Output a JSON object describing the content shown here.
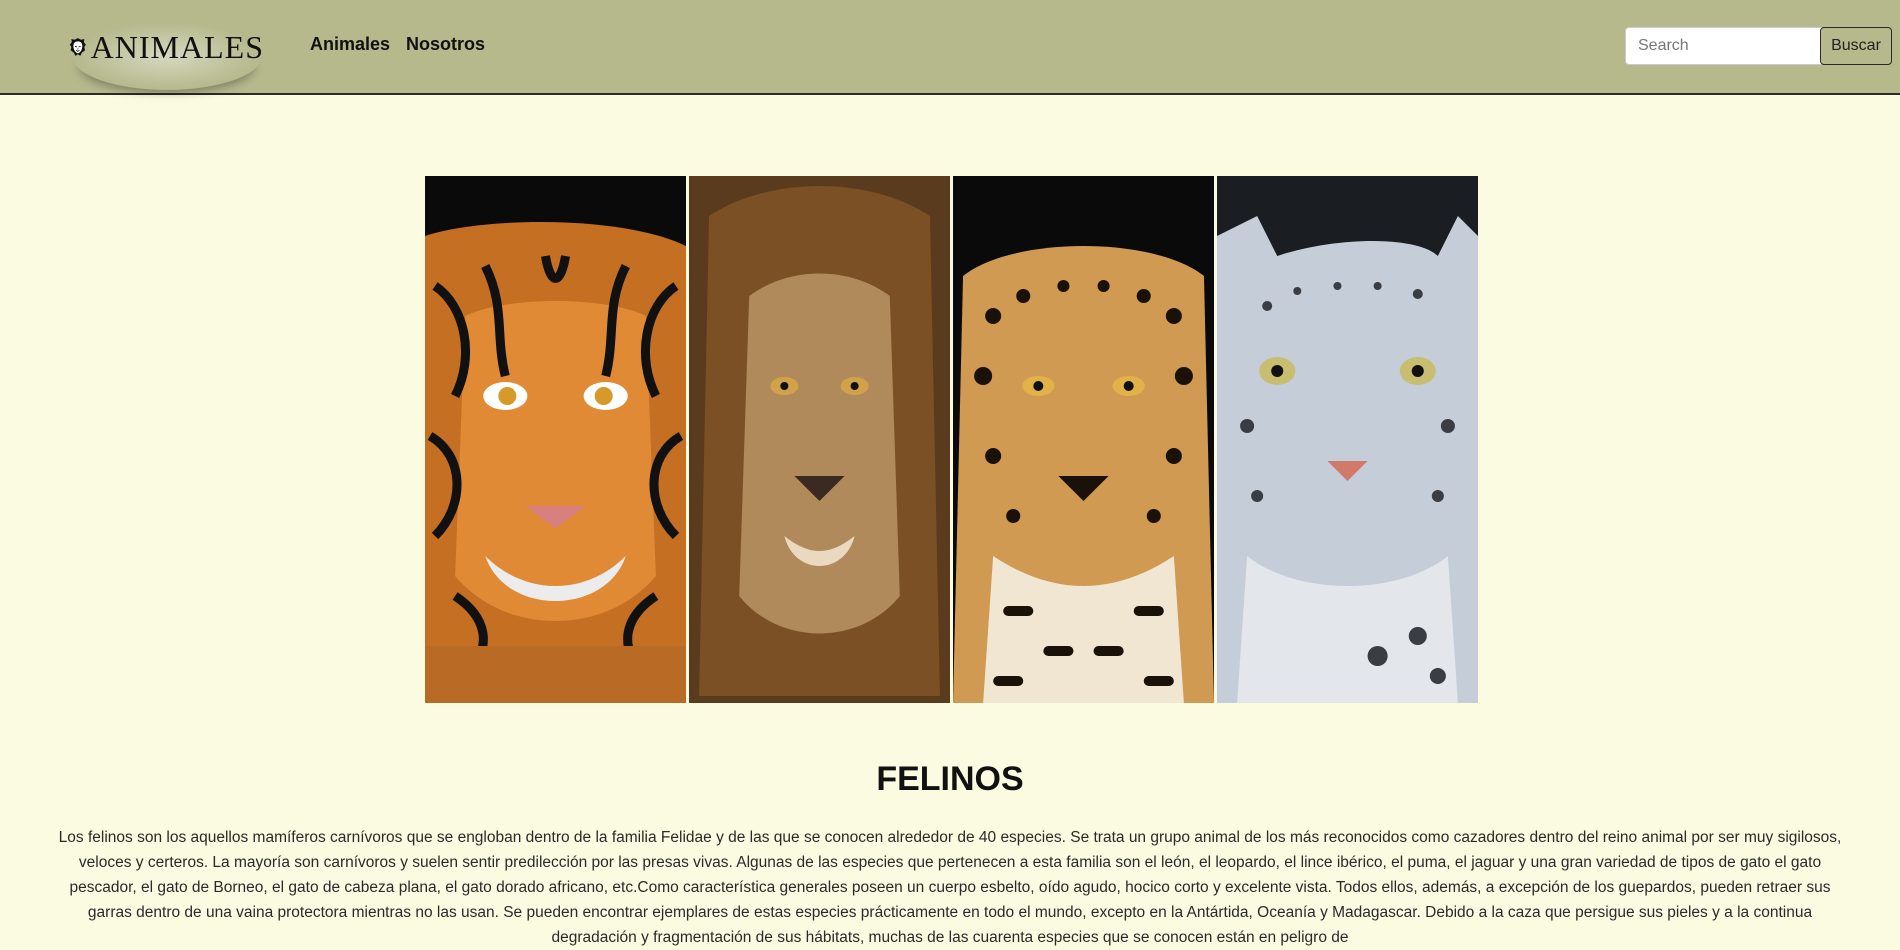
{
  "navbar": {
    "brand": "ANIMALES",
    "links": [
      "Animales",
      "Nosotros"
    ],
    "search": {
      "placeholder": "Search",
      "button_label": "Buscar"
    }
  },
  "hero": {
    "panels": [
      "tiger-image",
      "lion-image",
      "jaguar-image",
      "snow-leopard-image"
    ]
  },
  "section": {
    "title": "FELINOS",
    "description": "Los felinos son los aquellos mamíferos carnívoros que se engloban dentro de la familia Felidae y de las que se conocen alrededor de 40 especies. Se trata un grupo animal de los más reconocidos como cazadores dentro del reino animal por ser muy sigilosos, veloces y certeros. La mayoría son carnívoros y suelen sentir predilección por las presas vivas. Algunas de las especies que pertenecen a esta familia son el león, el leopardo, el lince ibérico, el puma, el jaguar y una gran variedad de tipos de gato el gato pescador, el gato de Borneo, el gato de cabeza plana, el gato dorado africano, etc.Como característica generales poseen un cuerpo esbelto, oído agudo, hocico corto y excelente vista. Todos ellos, además, a excepción de los guepardos, pueden retraer sus garras dentro de una vaina protectora mientras no las usan. Se pueden encontrar ejemplares de estas especies prácticamente en todo el mundo, excepto en la Antártida, Oceanía y Madagascar. Debido a la caza que persigue sus pieles y a la continua degradación y fragmentación de sus hábitats, muchas de las cuarenta especies que se conocen están en peligro de"
  }
}
